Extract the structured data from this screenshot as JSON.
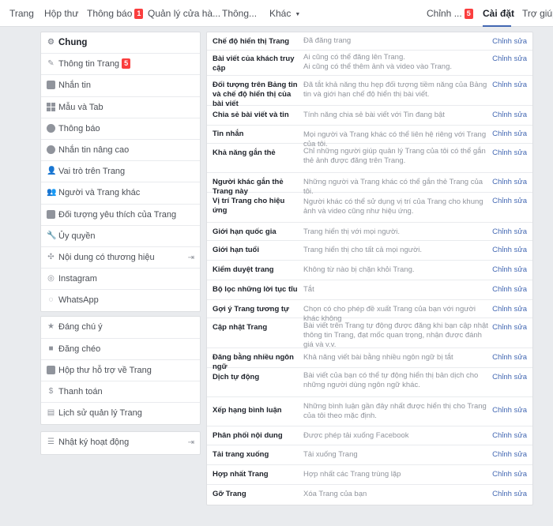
{
  "topnav": {
    "items": [
      "Trang",
      "Hộp thư",
      "Thông báo",
      "Quản lý cửa hà...",
      "Thông...",
      "Khác"
    ],
    "notif_badge": "1",
    "edit_label": "Chỉnh ...",
    "edit_badge": "5",
    "settings_label": "Cài đặt",
    "help_label": "Trợ giúp"
  },
  "sidebar": {
    "group1": [
      {
        "label": "Chung",
        "icon": "gear-icon"
      },
      {
        "label": "Thông tin Trang",
        "icon": "pencil-icon",
        "badge": "5"
      },
      {
        "label": "Nhắn tin",
        "icon": "chat-icon"
      },
      {
        "label": "Mẫu và Tab",
        "icon": "grid-icon"
      },
      {
        "label": "Thông báo",
        "icon": "globe-icon"
      },
      {
        "label": "Nhắn tin nâng cao",
        "icon": "messenger-icon"
      },
      {
        "label": "Vai trò trên Trang",
        "icon": "person-icon"
      },
      {
        "label": "Người và Trang khác",
        "icon": "people-icon"
      },
      {
        "label": "Đối tượng yêu thích của Trang",
        "icon": "audience-icon"
      },
      {
        "label": "Ủy quyền",
        "icon": "wrench-icon"
      },
      {
        "label": "Nội dung có thương hiệu",
        "icon": "handshake-icon"
      },
      {
        "label": "Instagram",
        "icon": "instagram-icon"
      },
      {
        "label": "WhatsApp",
        "icon": "whatsapp-icon"
      }
    ],
    "group2": [
      {
        "label": "Đáng chú ý",
        "icon": "star-icon"
      },
      {
        "label": "Đăng chéo",
        "icon": "video-icon"
      },
      {
        "label": "Hộp thư hỗ trợ về Trang",
        "icon": "page-icon"
      },
      {
        "label": "Thanh toán",
        "icon": "dollar-icon"
      },
      {
        "label": "Lịch sử quản lý Trang",
        "icon": "history-icon"
      }
    ],
    "group3": [
      {
        "label": "Nhật ký hoạt động",
        "icon": "list-icon"
      }
    ]
  },
  "settings": {
    "edit_label": "Chỉnh sửa",
    "rows": [
      {
        "name": "Chế độ hiển thị Trang",
        "value": "Đã đăng trang"
      },
      {
        "name": "Bài viết của khách truy cập",
        "value": "Ai cũng có thể đăng lên Trang.\nAi cũng có thể thêm ảnh và video vào Trang."
      },
      {
        "name": "Đối tượng trên Bảng tin và chế độ hiển thị của bài viết",
        "value": "Đã tắt khả năng thu hẹp đối tượng tiềm năng của Bảng tin và giới hạn chế độ hiển thị bài viết."
      },
      {
        "name": "Chia sẻ bài viết và tin",
        "value": "Tính năng chia sẻ bài viết với Tin đang bật"
      },
      {
        "name": "Tin nhắn",
        "value": "Mọi người và Trang khác có thể liên hệ riêng với Trang của tôi."
      },
      {
        "name": "Khả năng gắn thẻ",
        "value": "Chỉ những người giúp quản lý Trang của tôi có thể gắn thẻ ảnh được đăng trên Trang."
      },
      {
        "name": "Người khác gắn thẻ Trang này",
        "value": "Những người và Trang khác có thể gắn thẻ Trang của tôi."
      },
      {
        "name": "Vị trí Trang cho hiệu ứng",
        "value": "Người khác có thể sử dụng vị trí của Trang cho khung ảnh và video cũng như hiệu ứng."
      },
      {
        "name": "Giới hạn quốc gia",
        "value": "Trang hiển thị với mọi người."
      },
      {
        "name": "Giới hạn tuổi",
        "value": "Trang hiển thị cho tất cả mọi người."
      },
      {
        "name": "Kiểm duyệt trang",
        "value": "Không từ nào bị chặn khỏi Trang."
      },
      {
        "name": "Bộ lọc những lời tục tĩu",
        "value": "Tắt"
      },
      {
        "name": "Gợi ý Trang tương tự",
        "value": "Chọn có cho phép đề xuất Trang của bạn với người khác không"
      },
      {
        "name": "Cập nhật Trang",
        "value": "Bài viết trên Trang tự động được đăng khi bạn cập nhật thông tin Trang, đạt mốc quan trọng, nhận được đánh giá và v.v."
      },
      {
        "name": "Đăng bằng nhiều ngôn ngữ",
        "value": "Khả năng viết bài bằng nhiều ngôn ngữ bị tắt"
      },
      {
        "name": "Dịch tự động",
        "value": "Bài viết của bạn có thể tự động hiển thị bản dịch cho những người dùng ngôn ngữ khác."
      },
      {
        "name": "Xếp hạng bình luận",
        "value": "Những bình luận gần đây nhất được hiển thị cho Trang của tôi theo mặc định."
      },
      {
        "name": "Phân phối nội dung",
        "value": "Được phép tải xuống Facebook"
      },
      {
        "name": "Tải trang xuống",
        "value": "Tải xuống Trang"
      },
      {
        "name": "Hợp nhất Trang",
        "value": "Hợp nhất các Trang trùng lặp"
      },
      {
        "name": "Gỡ Trang",
        "value": "Xóa Trang của bạn"
      }
    ]
  }
}
